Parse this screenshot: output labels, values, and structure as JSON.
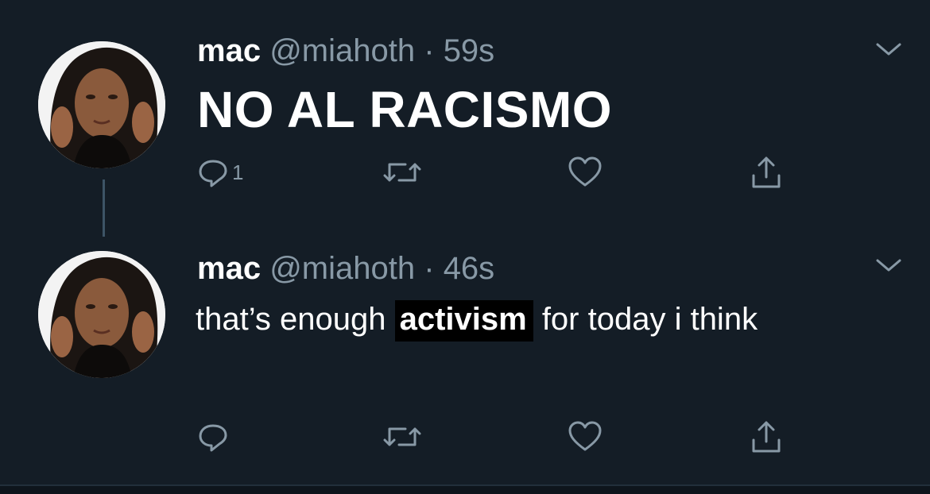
{
  "tweets": [
    {
      "name": "mac",
      "handle": "@miahoth",
      "separator": "·",
      "time": "59s",
      "text": "NO AL RACISMO",
      "reply_count": "1"
    },
    {
      "name": "mac",
      "handle": "@miahoth",
      "separator": "·",
      "time": "46s",
      "text_before": "that’s enough ",
      "text_highlight": "activism",
      "text_after": " for today i think",
      "reply_count": ""
    }
  ],
  "icons": {
    "reply": "reply-icon",
    "retweet": "retweet-icon",
    "like": "heart-icon",
    "share": "share-icon",
    "caret": "chevron-down-icon"
  },
  "colors": {
    "background": "#141d26",
    "secondary_text": "#8899a6",
    "highlight_bg": "#000000"
  }
}
